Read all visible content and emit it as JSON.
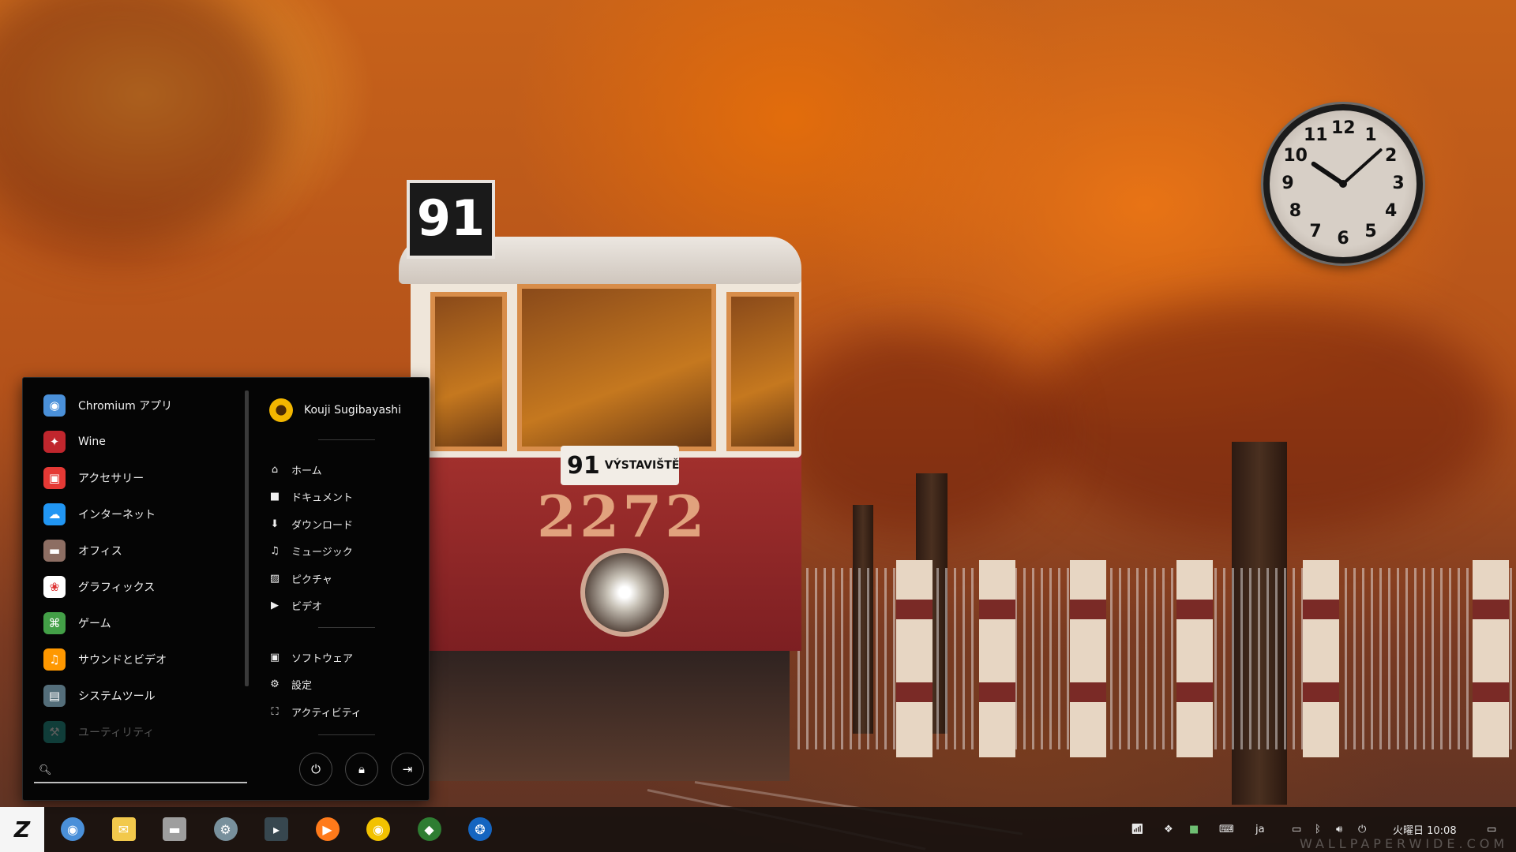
{
  "menu": {
    "categories": [
      {
        "label": "Chromium アプリ",
        "icon": "chromium-icon",
        "color": "#4a90d9"
      },
      {
        "label": "Wine",
        "icon": "wine-icon",
        "color": "#c0262d"
      },
      {
        "label": "アクセサリー",
        "icon": "accessories-icon",
        "color": "#e53935"
      },
      {
        "label": "インターネット",
        "icon": "internet-icon",
        "color": "#2196f3"
      },
      {
        "label": "オフィス",
        "icon": "office-icon",
        "color": "#8d6e63"
      },
      {
        "label": "グラフィックス",
        "icon": "graphics-icon",
        "color": "#ffffff"
      },
      {
        "label": "ゲーム",
        "icon": "games-icon",
        "color": "#43a047"
      },
      {
        "label": "サウンドとビデオ",
        "icon": "sound-video-icon",
        "color": "#ff9800"
      },
      {
        "label": "システムツール",
        "icon": "system-tools-icon",
        "color": "#546e7a"
      },
      {
        "label": "ユーティリティ",
        "icon": "utilities-icon",
        "color": "#26a69a"
      }
    ],
    "search": {
      "value": "",
      "placeholder": ""
    },
    "user": {
      "name": "Kouji Sugibayashi"
    },
    "places": [
      {
        "label": "ホーム",
        "icon": "home-icon"
      },
      {
        "label": "ドキュメント",
        "icon": "document-icon"
      },
      {
        "label": "ダウンロード",
        "icon": "download-icon"
      },
      {
        "label": "ミュージック",
        "icon": "music-icon"
      },
      {
        "label": "ピクチャ",
        "icon": "picture-icon"
      },
      {
        "label": "ビデオ",
        "icon": "video-icon"
      }
    ],
    "system_links": [
      {
        "label": "ソフトウェア",
        "icon": "software-icon"
      },
      {
        "label": "設定",
        "icon": "settings-icon"
      },
      {
        "label": "アクティビティ",
        "icon": "activities-icon"
      }
    ],
    "power_buttons": [
      "power-icon",
      "lock-icon",
      "logout-icon"
    ]
  },
  "taskbar": {
    "launchers": [
      {
        "name": "chromium-launcher",
        "icon": "chromium-icon",
        "color": "#4a90d9"
      },
      {
        "name": "mail-launcher",
        "icon": "mail-icon",
        "color": "#f2c94c"
      },
      {
        "name": "files-launcher",
        "icon": "folder-icon",
        "color": "#9e9e9e"
      },
      {
        "name": "settings-launcher",
        "icon": "gear-icon",
        "color": "#78909c"
      },
      {
        "name": "terminal-launcher",
        "icon": "terminal-icon",
        "color": "#37474f"
      },
      {
        "name": "media-player-launcher",
        "icon": "play-icon",
        "color": "#ff7a1a"
      },
      {
        "name": "music-player-launcher",
        "icon": "speaker-icon",
        "color": "#f2c200"
      },
      {
        "name": "inkscape-launcher",
        "icon": "vector-icon",
        "color": "#2e7d32"
      },
      {
        "name": "camera-app-launcher",
        "icon": "aperture-icon",
        "color": "#1565c0"
      }
    ],
    "tray": {
      "network_icon": "wireless-icon",
      "dropbox_icon": "dropbox-icon",
      "keyboard_icon": "keyboard-icon",
      "language": "ja",
      "clock": "火曜日 10:08"
    }
  },
  "desktop": {
    "clock_widget": {
      "hour": 10,
      "minute": 8,
      "numerals": [
        "12",
        "1",
        "2",
        "3",
        "4",
        "5",
        "6",
        "7",
        "8",
        "9",
        "10",
        "11"
      ]
    },
    "tram_route": "91",
    "tram_destination": "VÝSTAVIŠTĚ",
    "tram_number": "2272",
    "watermark": "WALLPAPERWIDE.COM"
  }
}
